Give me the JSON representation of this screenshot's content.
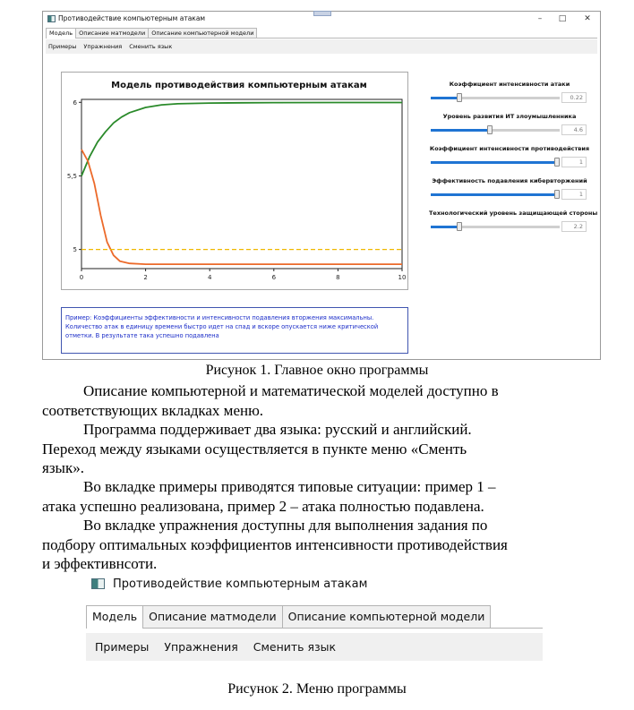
{
  "figure1": {
    "window_title": "Противодействие компьютерным атакам",
    "window_controls": [
      "–",
      "□",
      "✕"
    ],
    "tabs": [
      "Модель",
      "Описание матмодели",
      "Описание компьютерной модели"
    ],
    "menu": [
      "Примеры",
      "Упражнения",
      "Сменить язык"
    ],
    "chart_data": {
      "type": "line",
      "title": "Модель противодействия компьютерным атакам",
      "xlabel": "",
      "ylabel": "",
      "xlim": [
        0,
        10
      ],
      "ylim": [
        4.87,
        6.02
      ],
      "x_ticks": [
        "0",
        "2",
        "4",
        "6",
        "8",
        "10"
      ],
      "y_ticks": [
        "5",
        "5,5",
        "6"
      ],
      "grid": false,
      "series": [
        {
          "color": "#2a8a2a",
          "x": [
            0,
            0.25,
            0.5,
            0.75,
            1,
            1.25,
            1.5,
            2,
            2.5,
            3,
            4,
            5,
            6,
            8,
            10
          ],
          "y": [
            5.5,
            5.63,
            5.73,
            5.8,
            5.86,
            5.9,
            5.93,
            5.965,
            5.983,
            5.99,
            5.995,
            5.997,
            5.998,
            5.999,
            5.999
          ]
        },
        {
          "color": "#ec6a2a",
          "x": [
            0,
            0.2,
            0.4,
            0.6,
            0.8,
            1,
            1.2,
            1.5,
            2,
            3,
            4,
            6,
            8,
            10
          ],
          "y": [
            5.68,
            5.6,
            5.45,
            5.23,
            5.05,
            4.96,
            4.92,
            4.905,
            4.9,
            4.9,
            4.9,
            4.9,
            4.9,
            4.9
          ]
        },
        {
          "color": "#f0b800",
          "style": "dashed",
          "x": [
            0,
            10
          ],
          "y": [
            5.0,
            5.0
          ]
        }
      ]
    },
    "sliders": [
      {
        "label": "Коэффициент интенсивности атаки",
        "value": "0.22",
        "fraction": 0.22
      },
      {
        "label": "Уровень развития ИТ злоумышленника",
        "value": "4.6",
        "fraction": 0.46
      },
      {
        "label": "Коэффициент интенсивности противодействия",
        "value": "1",
        "fraction": 1.0
      },
      {
        "label": "Эффективность подавления кибервторжений",
        "value": "1",
        "fraction": 1.0
      },
      {
        "label": "Технологический уровень защищающей стороны",
        "value": "2.2",
        "fraction": 0.22
      }
    ],
    "note": "Пример: Коэффициенты эффективности и интенсивности подавления вторжения максимальны. Количество атак в единицу времени быстро идет на спад и вскоре опускается ниже критической отметки. В результате така успешно подавлена",
    "caption": "Рисунок 1. Главное окно программы"
  },
  "paragraphs": [
    [
      "Описание компьютерной и математической моделей доступно в",
      "соответствующих вкладках меню."
    ],
    [
      "Программа поддерживает два языка: русский и английский.",
      "Переход между языками осуществляется в пункте меню «Сменть",
      "язык»."
    ],
    [
      "Во вкладке примеры приводятся типовые ситуации: пример 1 –",
      "атака успешно реализована, пример 2 – атака полностью подавлена."
    ],
    [
      "Во вкладке упражнения доступны для выполнения задания по",
      "подбору оптимальных коэффициентов интенсивности противодействия",
      "и эффективнсоти."
    ]
  ],
  "figure2": {
    "window_title": "Противодействие компьютерным атакам",
    "tabs": [
      "Модель",
      "Описание матмодели",
      "Описание компьютерной модели"
    ],
    "menu": [
      "Примеры",
      "Упражнения",
      "Сменить язык"
    ],
    "caption": "Рисунок 2. Меню программы"
  }
}
